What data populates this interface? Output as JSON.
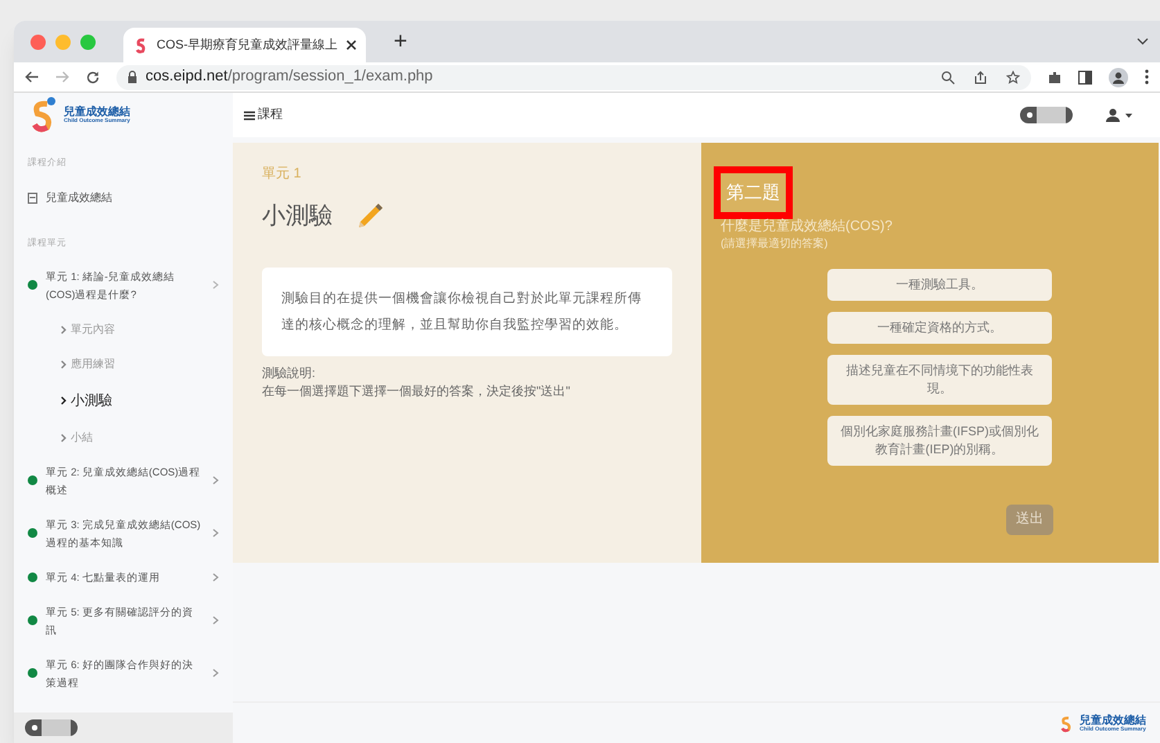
{
  "browser": {
    "tab_title": "COS-早期療育兒童成效評量線上",
    "new_tab": "+",
    "url_host": "cos.eipd.net",
    "url_path": "/program/session_1/exam.php"
  },
  "header": {
    "logo_title": "兒童成效總結",
    "logo_subtitle": "Child Outcome Summary",
    "menu_label": "課程",
    "toggle_on": false
  },
  "sidebar": {
    "toggle_on": false,
    "sections": [
      {
        "heading": "課程介紹",
        "items": [
          {
            "kind": "page",
            "label": "兒童成效總結",
            "selected": false
          }
        ]
      },
      {
        "heading": "課程單元",
        "items": [
          {
            "kind": "unit",
            "label": "單元 1: 緒論-兒童成效總結(COS)過程是什麼?",
            "color": "#118844",
            "expanded": true,
            "children": [
              {
                "label": "單元內容",
                "selected": false
              },
              {
                "label": "應用練習",
                "selected": false
              },
              {
                "label": "小測驗",
                "selected": true
              },
              {
                "label": "小結",
                "selected": false
              }
            ]
          },
          {
            "kind": "unit",
            "label": "單元 2: 兒童成效總結(COS)過程概述",
            "color": "#118844",
            "expanded": false
          },
          {
            "kind": "unit",
            "label": "單元 3: 完成兒童成效總結(COS)過程的基本知識",
            "color": "#118844",
            "expanded": false
          },
          {
            "kind": "unit",
            "label": "單元 4: 七點量表的運用",
            "color": "#118844",
            "expanded": false
          },
          {
            "kind": "unit",
            "label": "單元 5: 更多有關確認評分的資訊",
            "color": "#118844",
            "expanded": false
          },
          {
            "kind": "unit",
            "label": "單元 6: 好的團隊合作與好的決策過程",
            "color": "#118844",
            "expanded": false
          }
        ]
      }
    ]
  },
  "intro": {
    "unit_label": "單元 1",
    "title": "小測驗",
    "description": "測驗目的在提供一個機會讓你檢視自己對於此單元課程所傳達的核心概念的理解，並且幫助你自我監控學習的效能。",
    "instructions_label": "測驗說明:",
    "instructions": "在每一個選擇題下選擇一個最好的答案，決定後按\"送出\""
  },
  "question": {
    "number": "第二題",
    "highlighted": true,
    "text": "什麼是兒童成效總結(COS)?",
    "hint": "(請選擇最適切的答案)",
    "options": [
      {
        "label": "一種測驗工具。",
        "selected": false
      },
      {
        "label": "一種確定資格的方式。",
        "selected": false
      },
      {
        "label": "描述兒童在不同情境下的功能性表現。",
        "selected": false
      },
      {
        "label": "個別化家庭服務計畫(IFSP)或個別化教育計畫(IEP)的別稱。",
        "selected": false
      }
    ],
    "submit": "送出"
  },
  "footer": {
    "logo_title": "兒童成效總結",
    "logo_subtitle": "Child Outcome Summary"
  }
}
